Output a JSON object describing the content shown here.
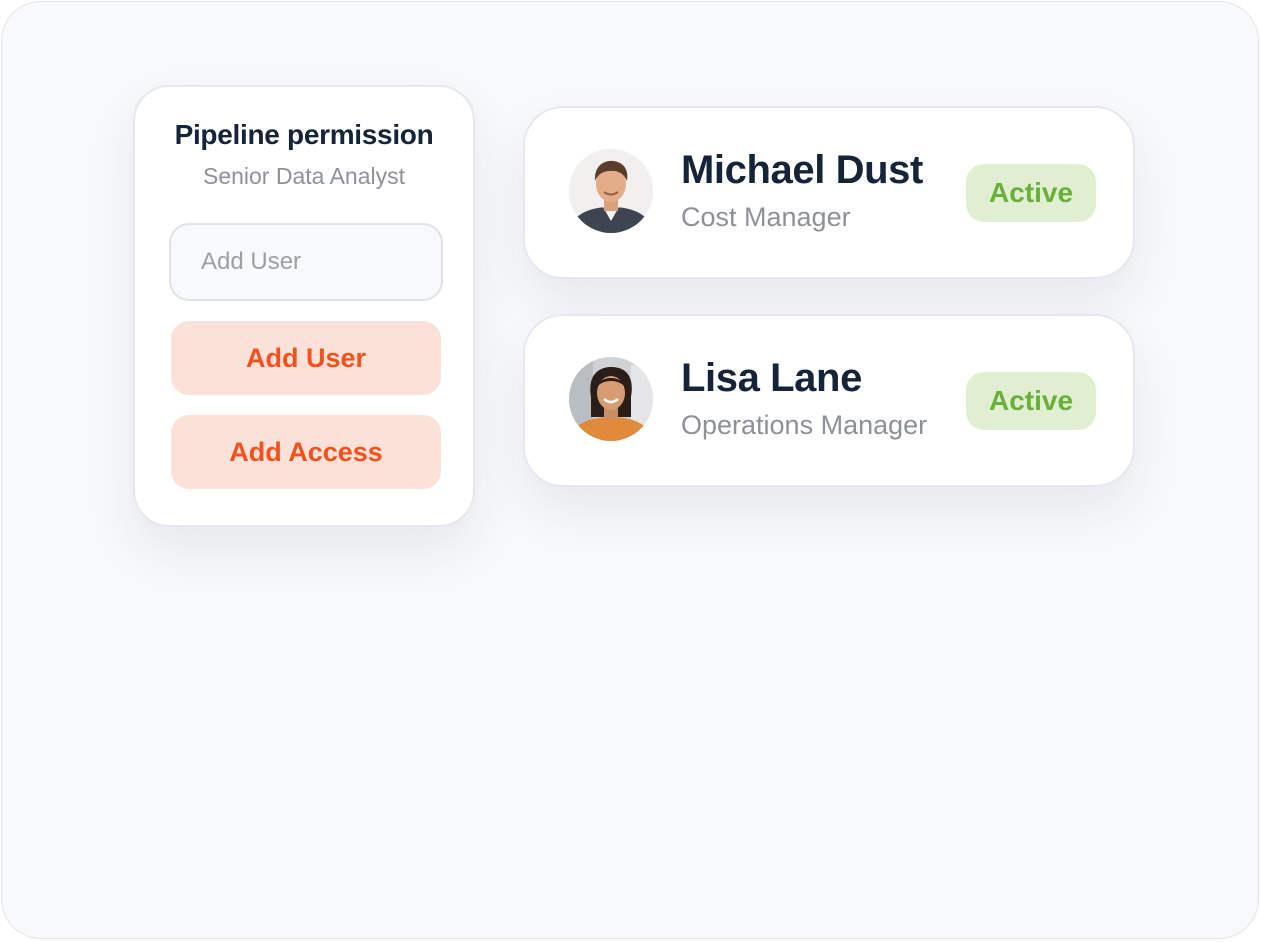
{
  "permission_card": {
    "title": "Pipeline permission",
    "subtitle": "Senior Data Analyst",
    "input_placeholder": "Add User",
    "add_user_label": "Add User",
    "add_access_label": "Add Access"
  },
  "users": [
    {
      "name": "Michael Dust",
      "role": "Cost Manager",
      "status": "Active",
      "avatar": "avatar-photo-man"
    },
    {
      "name": "Lisa Lane",
      "role": "Operations Manager",
      "status": "Active",
      "avatar": "avatar-photo-woman"
    }
  ],
  "colors": {
    "title_text": "#16243a",
    "muted_text": "#8d9198",
    "accent_orange": "#f4511e",
    "accent_orange_bg": "#fbe1d7",
    "status_green": "#6aaf37",
    "status_green_bg": "#e0efd2",
    "canvas_bg": "#f8f9fb"
  }
}
